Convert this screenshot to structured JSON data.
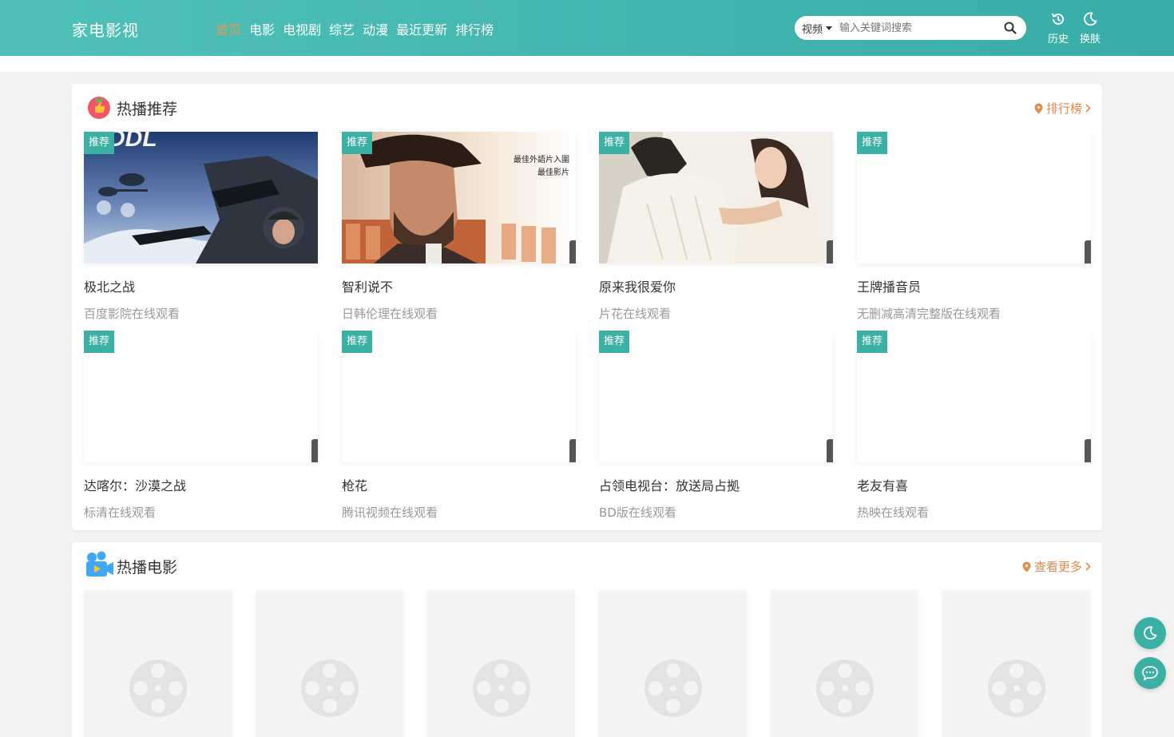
{
  "site": {
    "logo": "家电影视"
  },
  "nav": [
    {
      "label": "首页",
      "active": true
    },
    {
      "label": "电影"
    },
    {
      "label": "电视剧"
    },
    {
      "label": "综艺"
    },
    {
      "label": "动漫"
    },
    {
      "label": "最近更新"
    },
    {
      "label": "排行榜"
    }
  ],
  "search": {
    "type": "视频",
    "placeholder": "输入关键词搜索"
  },
  "header_buttons": {
    "history": "历史",
    "theme": "换肤"
  },
  "hot": {
    "title": "热播推荐",
    "more": "排行榜",
    "tag": "推荐",
    "items": [
      {
        "title": "极北之战",
        "sub": "百度影院在线观看"
      },
      {
        "title": "智利说不",
        "sub": "日韩伦理在线观看"
      },
      {
        "title": "原来我很爱你",
        "sub": "片花在线观看"
      },
      {
        "title": "王牌播音员",
        "sub": "无删减高清完整版在线观看"
      },
      {
        "title": "达喀尔：沙漠之战",
        "sub": "标清在线观看"
      },
      {
        "title": "枪花",
        "sub": "腾讯视频在线观看"
      },
      {
        "title": "占领电视台：放送局占拠",
        "sub": "BD版在线观看"
      },
      {
        "title": "老友有喜",
        "sub": "热映在线观看"
      }
    ],
    "poster2_text": [
      "最佳外語片入圍",
      "最佳影片"
    ]
  },
  "movies": {
    "title": "热播电影",
    "more": "查看更多"
  },
  "colors": {
    "accent": "#3bb0a5",
    "header": "#45b8b0",
    "orange": "#e28a4c"
  }
}
